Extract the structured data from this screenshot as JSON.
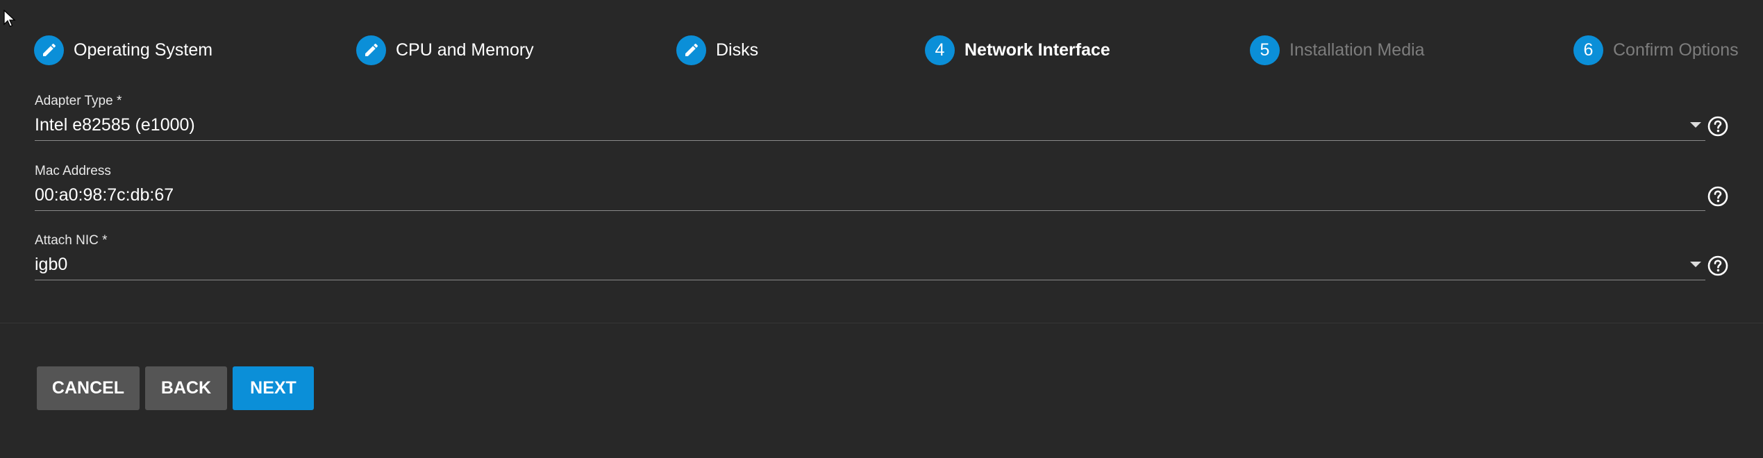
{
  "stepper": {
    "steps": [
      {
        "label": "Operating System",
        "state": "completed",
        "indicator": "pencil-icon"
      },
      {
        "label": "CPU and Memory",
        "state": "completed",
        "indicator": "pencil-icon"
      },
      {
        "label": "Disks",
        "state": "completed",
        "indicator": "pencil-icon"
      },
      {
        "label": "Network Interface",
        "state": "active",
        "number": "4"
      },
      {
        "label": "Installation Media",
        "state": "upcoming",
        "number": "5"
      },
      {
        "label": "Confirm Options",
        "state": "upcoming",
        "number": "6"
      }
    ]
  },
  "form": {
    "adapter_type": {
      "label": "Adapter Type *",
      "value": "Intel e82585 (e1000)"
    },
    "mac_address": {
      "label": "Mac Address",
      "value": "00:a0:98:7c:db:67"
    },
    "attach_nic": {
      "label": "Attach NIC *",
      "value": "igb0"
    }
  },
  "actions": {
    "cancel_label": "CANCEL",
    "back_label": "BACK",
    "next_label": "NEXT"
  },
  "colors": {
    "background": "#282828",
    "accent": "#0b8fd8",
    "secondary_button": "#555555",
    "disabled_text": "#7d7d7d"
  },
  "icons": {
    "completed_step": "pencil-icon",
    "help": "help-circle-icon",
    "select": "dropdown-arrow-icon",
    "pointer": "mouse-cursor-icon"
  }
}
